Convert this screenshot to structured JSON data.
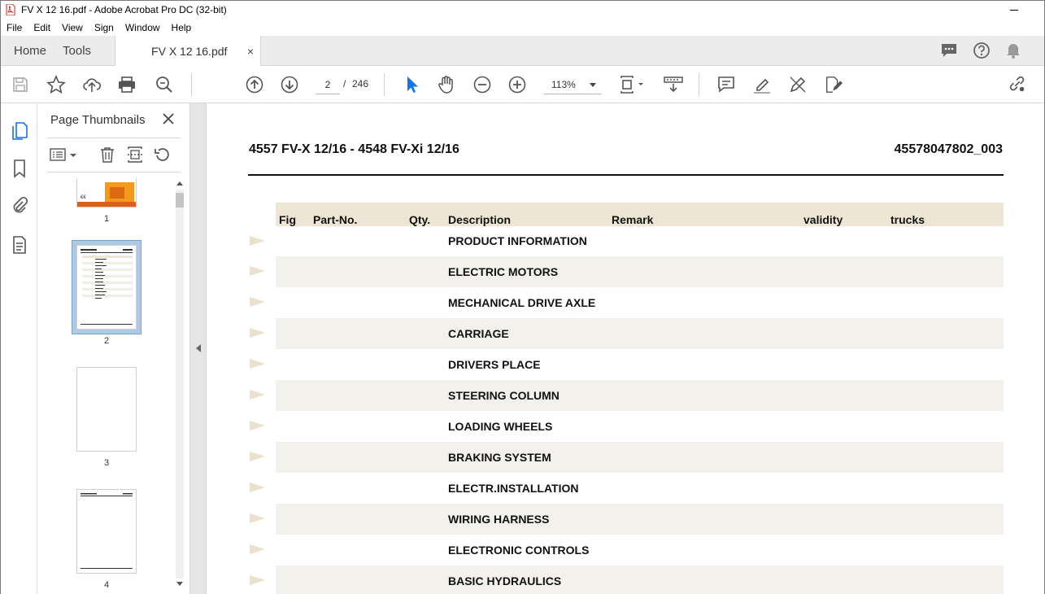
{
  "window": {
    "title": "FV X 12 16.pdf - Adobe Acrobat Pro DC (32-bit)"
  },
  "menu": [
    "File",
    "Edit",
    "View",
    "Sign",
    "Window",
    "Help"
  ],
  "tabs": {
    "home": "Home",
    "tools": "Tools",
    "document": "FV X 12 16.pdf",
    "close": "×"
  },
  "toolbar": {
    "current_page": "2",
    "page_separator": "/",
    "total_pages": "246",
    "zoom": "113%"
  },
  "thumbnail_panel": {
    "title": "Page Thumbnails",
    "pages": [
      "1",
      "2",
      "3",
      "4"
    ],
    "selected_page": "2"
  },
  "document": {
    "header_left": "4557 FV-X 12/16 - 4548 FV-Xi 12/16",
    "header_right": "45578047802_003",
    "columns": [
      "Fig",
      "Part-No.",
      "Qty.",
      "Description",
      "Remark",
      "validity",
      "trucks"
    ],
    "rows": [
      "PRODUCT INFORMATION",
      "ELECTRIC MOTORS",
      "MECHANICAL DRIVE AXLE",
      "CARRIAGE",
      "DRIVERS PLACE",
      "STEERING COLUMN",
      "LOADING WHEELS",
      "BRAKING SYSTEM",
      "ELECTR.INSTALLATION",
      "WIRING HARNESS",
      "ELECTRONIC CONTROLS",
      "BASIC HYDRAULICS"
    ]
  },
  "colors": {
    "accent_blue": "#1473e6",
    "header_beige": "#efe5d5",
    "row_shade": "#f3f1ec",
    "arrow_beige": "#ebe1cc"
  }
}
